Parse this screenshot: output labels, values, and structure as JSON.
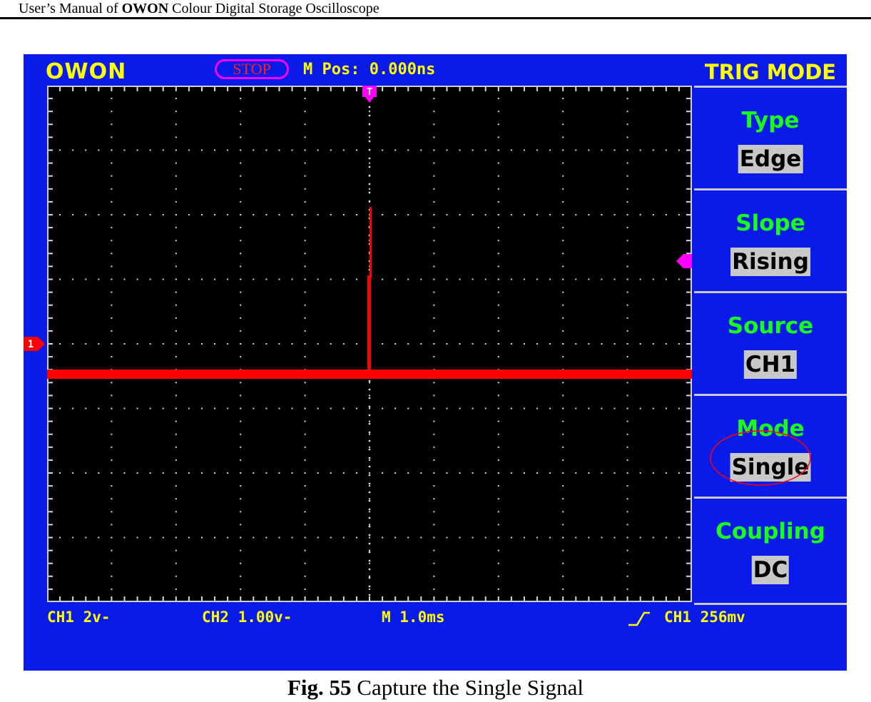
{
  "document": {
    "header_prefix": "User’s Manual of ",
    "header_brand": "OWON",
    "header_suffix": " Colour Digital Storage Oscilloscope",
    "caption_number": "Fig. 55",
    "caption_text": " Capture the Single Signal"
  },
  "scope": {
    "brand": "OWON",
    "run_state": "STOP",
    "mpos": "M Pos: 0.000ns",
    "menu_title": "TRIG MODE",
    "menu": [
      {
        "label": "Type",
        "value": "Edge"
      },
      {
        "label": "Slope",
        "value": "Rising"
      },
      {
        "label": "Source",
        "value": "CH1"
      },
      {
        "label": "Mode",
        "value": "Single"
      },
      {
        "label": "Coupling",
        "value": "DC"
      }
    ],
    "status": {
      "ch1": "CH1 2v-",
      "ch2": "CH2 1.00v-",
      "timebase": "M 1.0ms",
      "trigger": "CH1 256mv"
    },
    "markers": {
      "trigger_pos": "T",
      "channel": "1"
    },
    "colors": {
      "screen_bg": "#0a1ae8",
      "waveform": "#ff0000",
      "text": "#ffff00",
      "menu_label": "#1aff1a",
      "highlight": "#ff0000"
    }
  }
}
